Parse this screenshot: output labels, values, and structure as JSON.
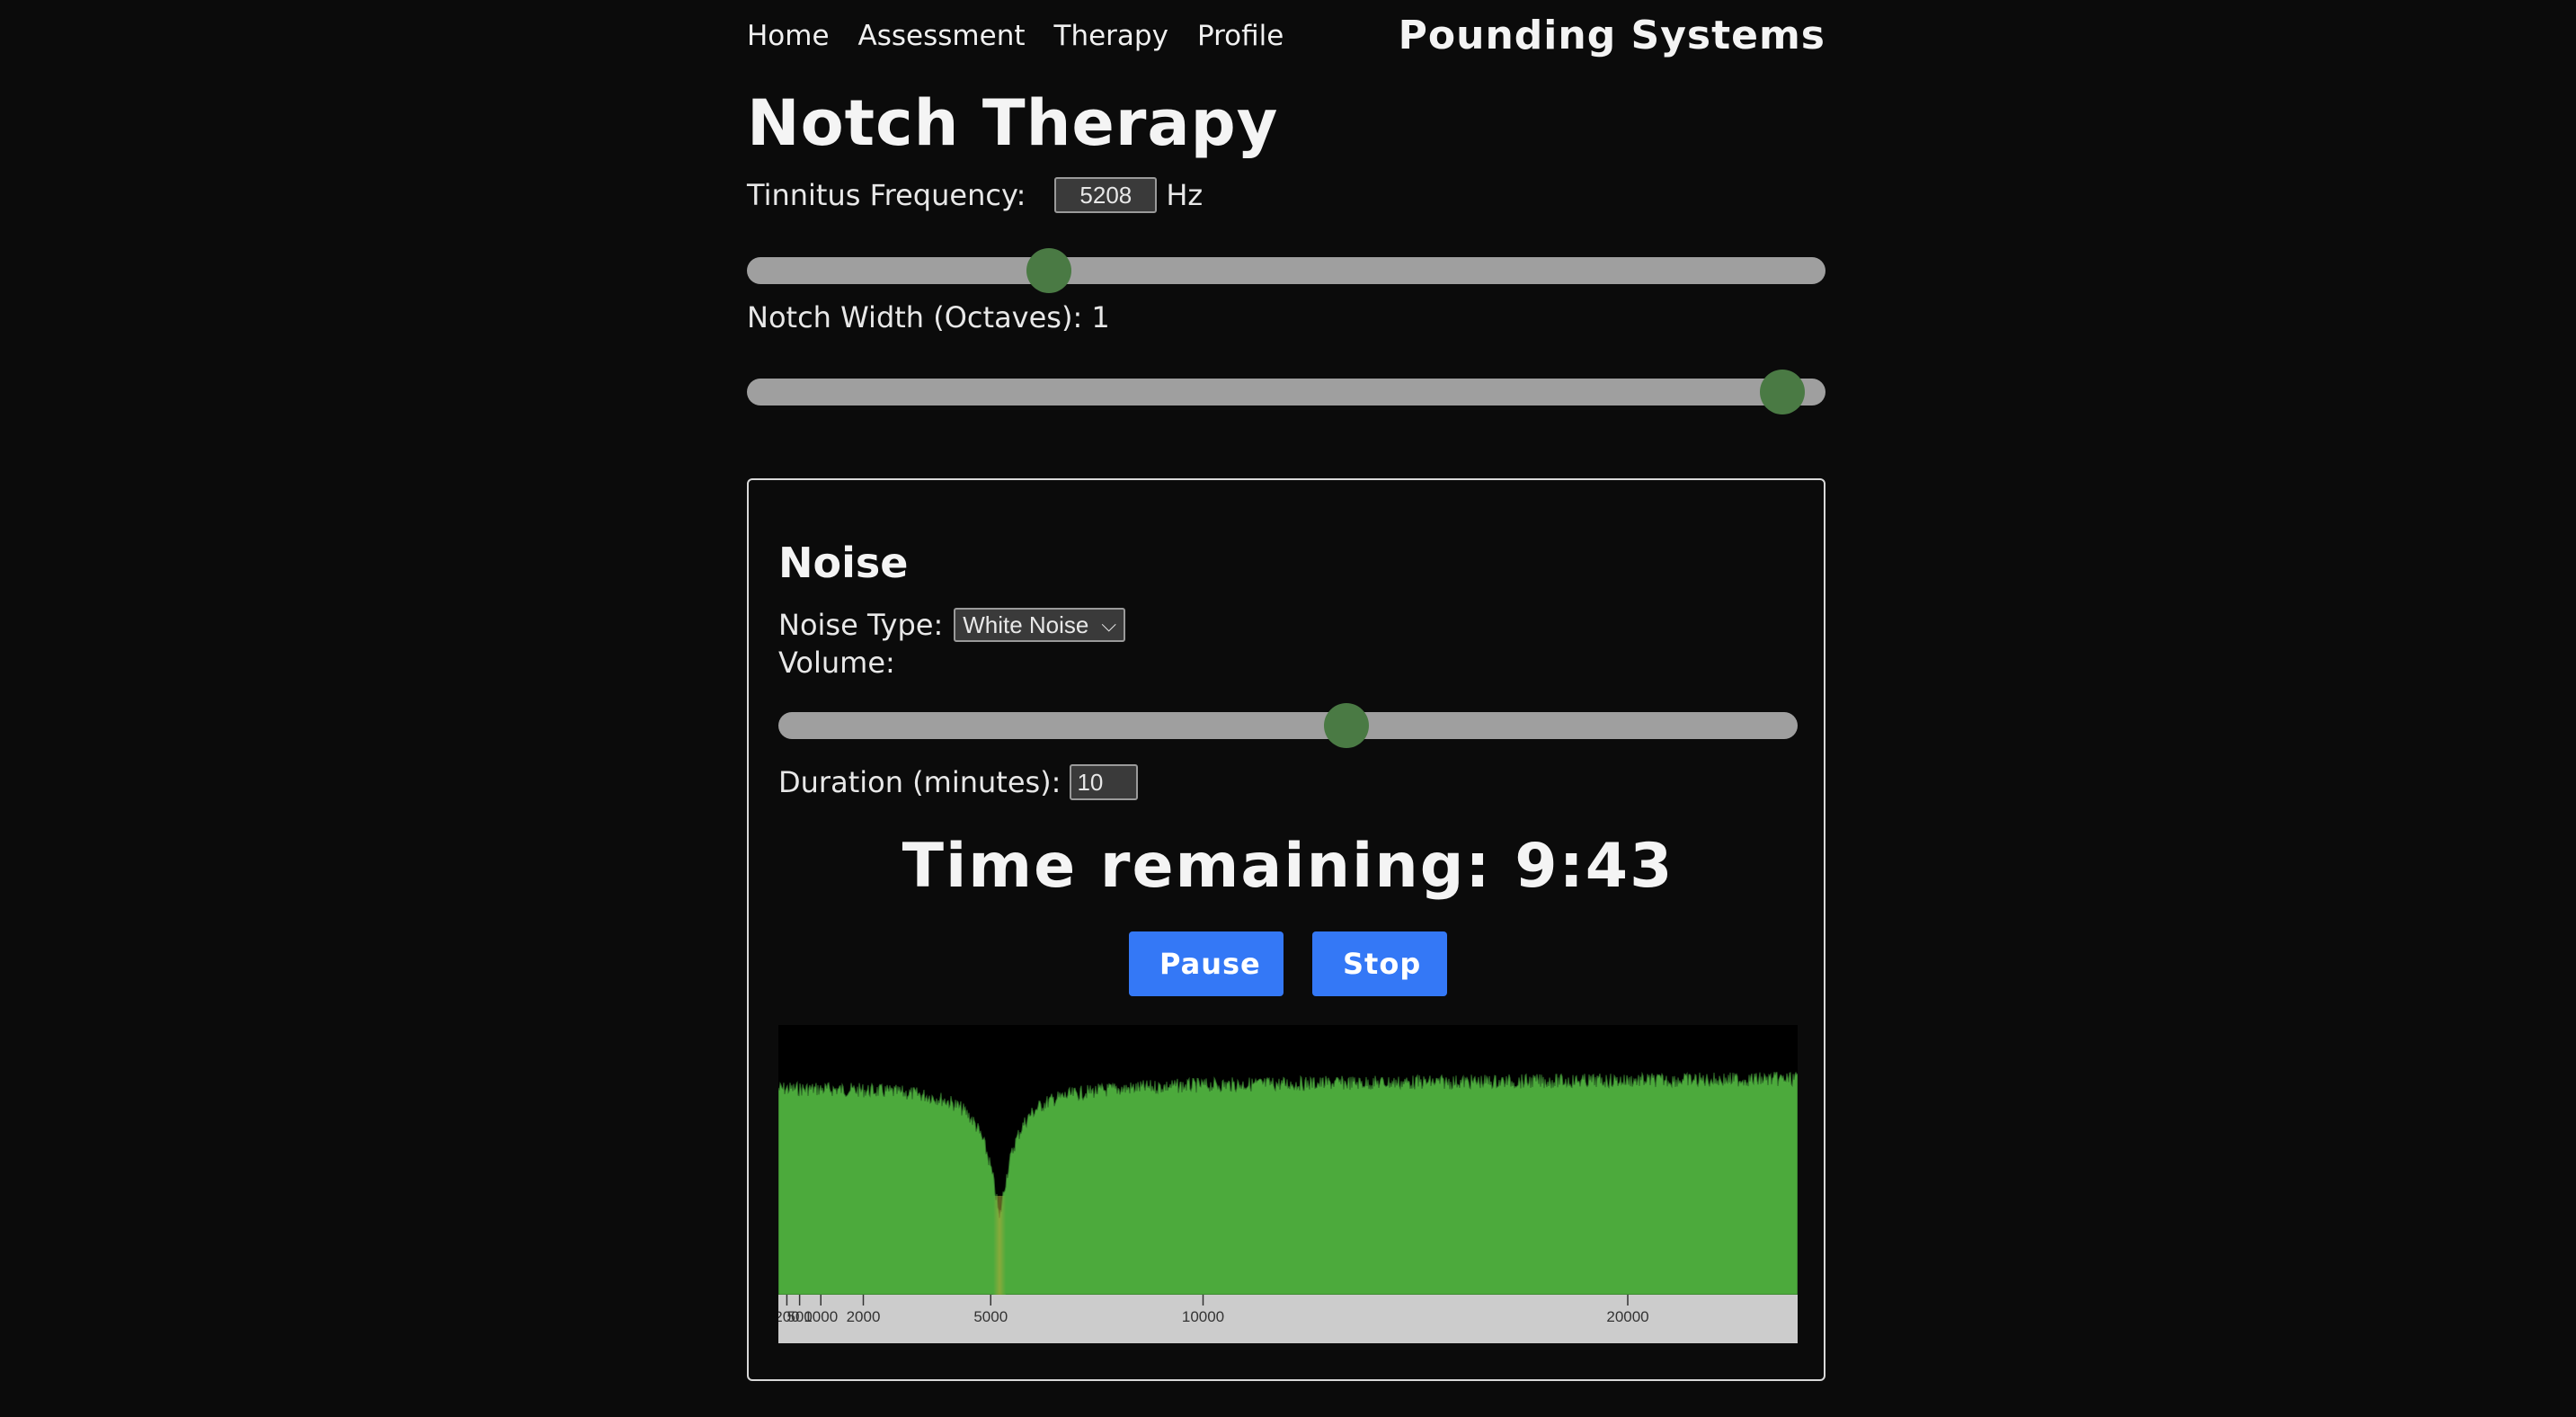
{
  "nav": {
    "items": [
      "Home",
      "Assessment",
      "Therapy",
      "Profile"
    ]
  },
  "brand": "Pounding Systems",
  "page_title": "Notch Therapy",
  "frequency": {
    "label": "Tinnitus Frequency:",
    "value": "5208",
    "unit": "Hz",
    "slider_fraction": 0.27
  },
  "notch_width": {
    "label": "Notch Width (Octaves): 1",
    "slider_fraction": 0.98
  },
  "noise_panel": {
    "title": "Noise",
    "noise_type_label": "Noise Type:",
    "noise_type_value": "White Noise",
    "volume_label": "Volume:",
    "volume_fraction": 0.56,
    "duration_label": "Duration (minutes):",
    "duration_value": "10",
    "time_remaining": "Time remaining: 9:43",
    "pause_label": "Pause",
    "stop_label": "Stop"
  },
  "colors": {
    "accent_button": "#3478f6",
    "slider_thumb": "#4a7a44",
    "slider_track": "#9f9f9f",
    "spectrum_fill": "#4caa3c",
    "spectrum_notch": "#b9a93a",
    "spectrum_bg": "#000000",
    "axis_bg": "#cccccc"
  },
  "chart_data": {
    "type": "area",
    "x_axis_ticks": [
      200,
      500,
      1000,
      2000,
      5000,
      10000,
      20000
    ],
    "x_tick_labels": [
      "200",
      "500",
      "1000",
      "2000",
      "5000",
      "10000",
      "20000"
    ],
    "xlim": [
      0,
      24000
    ],
    "notch_center_hz": 5208,
    "notch_width_octaves": 1
  }
}
